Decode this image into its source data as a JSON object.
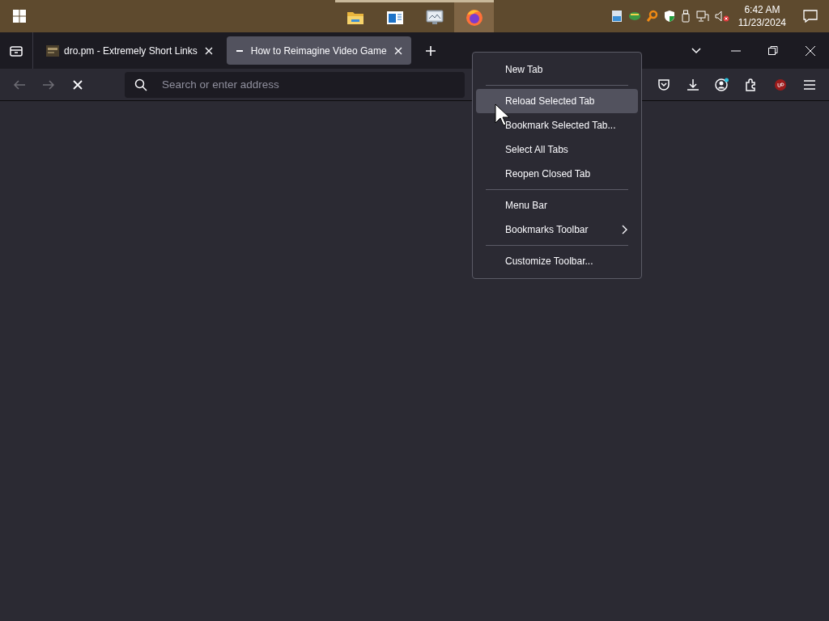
{
  "taskbar": {
    "apps": [
      {
        "kind": "folder",
        "selected": false
      },
      {
        "kind": "window",
        "selected": false
      },
      {
        "kind": "monitor",
        "selected": false
      },
      {
        "kind": "browser",
        "selected": true
      }
    ],
    "clock": {
      "time": "6:42 AM",
      "date": "11/23/2024"
    }
  },
  "tabs": [
    {
      "title": "dro.pm - Extremely Short Links",
      "selected": false
    },
    {
      "title": "How to Reimagine Video Game",
      "selected": true
    }
  ],
  "address_bar": {
    "placeholder": "Search or enter address"
  },
  "context_menu": {
    "items": [
      {
        "kind": "item",
        "label": "New Tab",
        "selected": false,
        "submenu": false
      },
      {
        "kind": "separator"
      },
      {
        "kind": "item",
        "label": "Reload Selected Tab",
        "selected": true,
        "submenu": false
      },
      {
        "kind": "item",
        "label": "Bookmark Selected Tab...",
        "selected": false,
        "submenu": false
      },
      {
        "kind": "item",
        "label": "Select All Tabs",
        "selected": false,
        "submenu": false
      },
      {
        "kind": "item",
        "label": "Reopen Closed Tab",
        "selected": false,
        "submenu": false
      },
      {
        "kind": "separator"
      },
      {
        "kind": "item",
        "label": "Menu Bar",
        "selected": false,
        "submenu": false
      },
      {
        "kind": "item",
        "label": "Bookmarks Toolbar",
        "selected": false,
        "submenu": true
      },
      {
        "kind": "separator"
      },
      {
        "kind": "item",
        "label": "Customize Toolbar...",
        "selected": false,
        "submenu": false
      }
    ]
  }
}
